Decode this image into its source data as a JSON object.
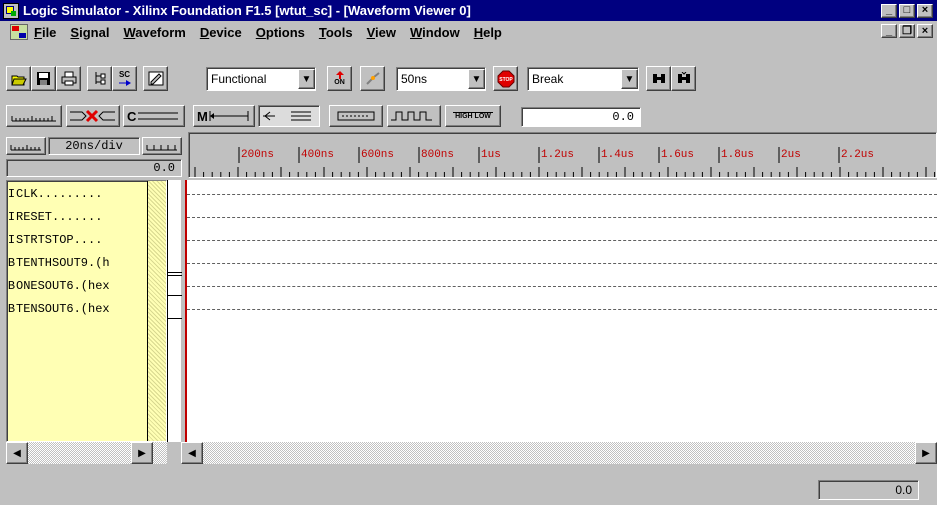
{
  "window": {
    "title": "Logic Simulator - Xilinx Foundation F1.5 [wtut_sc] - [Waveform Viewer 0]"
  },
  "menu": [
    "File",
    "Signal",
    "Waveform",
    "Device",
    "Options",
    "Tools",
    "View",
    "Window",
    "Help"
  ],
  "toolbar": {
    "mode_value": "Functional",
    "step_value": "50ns",
    "break_value": "Break",
    "icons": [
      "open-icon",
      "save-icon",
      "print-icon",
      "hierarchy-icon",
      "sc-probe-icon",
      "waveform-edit-icon",
      "power-on-icon",
      "connect-icon",
      "stop-icon",
      "find-icon",
      "find-next-icon"
    ],
    "on_label": "ON",
    "stop_label": "STOP",
    "sc_label": "SC"
  },
  "toolbar2": {
    "cursor_value": "0.0",
    "hilo_label": "HIGH LOW"
  },
  "ruler": {
    "scale_label": "20ns/div",
    "origin_value": "0.0",
    "ticks": [
      "200ns",
      "400ns",
      "600ns",
      "800ns",
      "1us",
      "1.2us",
      "1.4us",
      "1.6us",
      "1.8us",
      "2us",
      "2.2us"
    ]
  },
  "signals": [
    {
      "type": "I",
      "name": "CLK........."
    },
    {
      "type": "I",
      "name": "RESET......."
    },
    {
      "type": "I",
      "name": "STRTSTOP...."
    },
    {
      "type": "B",
      "name": "TENTHSOUT9.(h"
    },
    {
      "type": "B",
      "name": "ONESOUT6.(hex"
    },
    {
      "type": "B",
      "name": "TENSOUT6.(hex"
    }
  ],
  "status": {
    "value": "0.0"
  },
  "colors": {
    "titlebar": "#000080",
    "signal_bg": "#ffffb4",
    "cursor": "#c00000",
    "tick_label": "#c00000"
  }
}
